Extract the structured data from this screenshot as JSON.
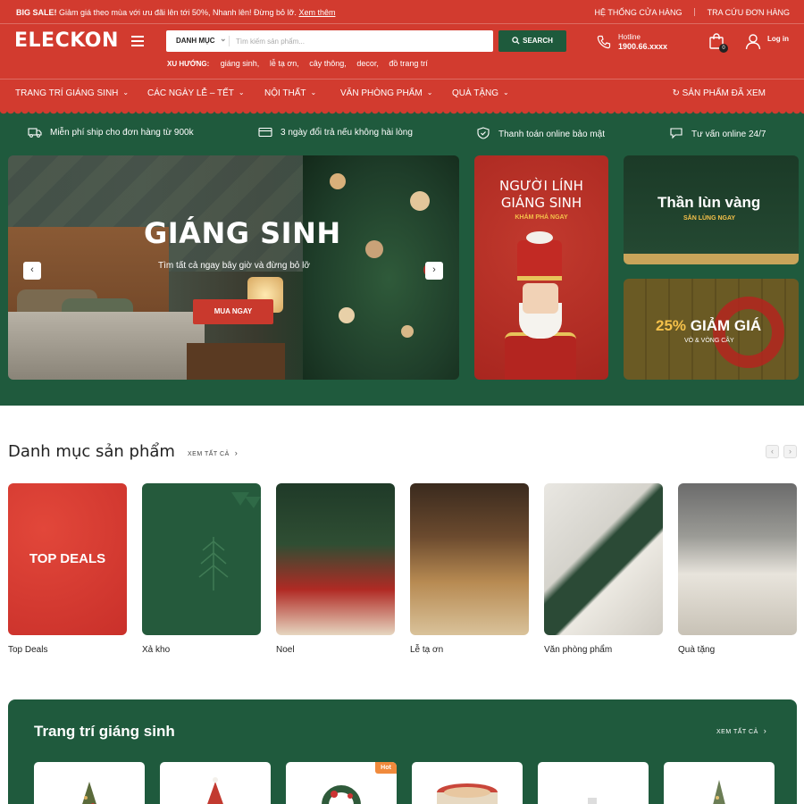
{
  "topbar": {
    "promo_bold": "BIG SALE!",
    "promo_text": "Giảm giá theo mùa với ưu đãi lên tới 50%, Nhanh lên! Đừng bỏ lỡ.",
    "promo_link": "Xem thêm",
    "store_link": "HỆ THỐNG CỬA HÀNG",
    "order_link": "TRA CỨU ĐƠN HÀNG"
  },
  "header": {
    "logo": "ELECKON",
    "search": {
      "category": "DANH MỤC",
      "placeholder": "Tìm kiếm sản phẩm...",
      "button": "SEARCH"
    },
    "trends_label": "XU HƯỚNG:",
    "trends": [
      "giáng sinh,",
      "lễ tạ ơn,",
      "cây thông,",
      "decor,",
      "đồ trang trí"
    ],
    "hotline_label": "Hotline",
    "hotline_number": "1900.66.xxxx",
    "cart_count": "0",
    "login": "Log in"
  },
  "nav": {
    "items": [
      "TRANG TRÍ GIÁNG SINH",
      "CÁC NGÀY LỄ – TẾT",
      "NỘI THẤT",
      "VĂN PHÒNG PHẨM",
      "QUÀ TẶNG"
    ],
    "seen": "SẢN PHẨM ĐÃ XEM"
  },
  "features": [
    {
      "icon": "truck-icon",
      "text": "Miễn phí ship cho đơn hàng từ 900k"
    },
    {
      "icon": "card-icon",
      "text": "3 ngày đổi trả nếu không hài lòng"
    },
    {
      "icon": "shield-icon",
      "text": "Thanh toán online bảo mật"
    },
    {
      "icon": "chat-icon",
      "text": "Tư vấn online 24/7"
    }
  ],
  "hero": {
    "title": "GIÁNG SINH",
    "subtitle": "Tìm tất cả ngay bây giờ và đừng bỏ lỡ",
    "cta": "MUA NGAY"
  },
  "promos": {
    "soldier_title_1": "NGƯỜI LÍNH",
    "soldier_title_2": "GIÁNG SINH",
    "soldier_sub": "KHÁM PHÁ NGAY",
    "gnome_title": "Thần lùn vàng",
    "gnome_sub": "SĂN LÙNG NGAY",
    "sale_pct": "25%",
    "sale_title": "GIẢM GIÁ",
    "sale_sub": "VÒ & VÒNG CÂY"
  },
  "categories": {
    "title": "Danh mục sản phẩm",
    "view_all": "XEM TẤT CẢ",
    "deal_text": "TOP DEALS",
    "items": [
      "Top Deals",
      "Xả kho",
      "Noel",
      "Lễ tạ ơn",
      "Văn phòng phẩm",
      "Quà tặng"
    ]
  },
  "decor": {
    "title": "Trang trí giáng sinh",
    "view_all": "XEM TẤT CẢ",
    "hot_badge": "Hot"
  },
  "colors": {
    "brand_red": "#d23b2f",
    "brand_green": "#1f5a3d",
    "accent_gold": "#f5c14a"
  }
}
